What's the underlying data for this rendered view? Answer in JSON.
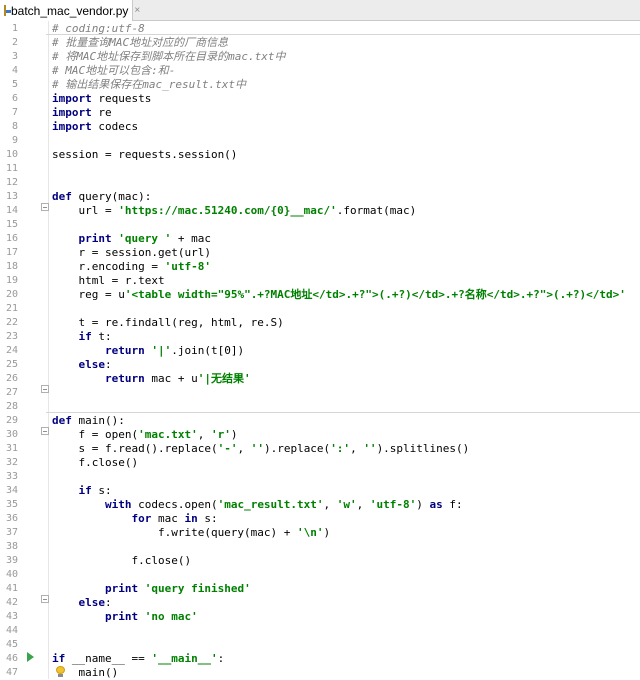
{
  "tab": {
    "filename": "batch_mac_vendor.py",
    "close": "×"
  },
  "editor": {
    "lines": [
      [
        {
          "t": "c",
          "v": "# coding:utf-8"
        }
      ],
      [
        {
          "t": "c",
          "v": "# 批量查询MAC地址对应的厂商信息"
        }
      ],
      [
        {
          "t": "c",
          "v": "# 将MAC地址保存到脚本所在目录的mac.txt中"
        }
      ],
      [
        {
          "t": "c",
          "v": "# MAC地址可以包含:和-"
        }
      ],
      [
        {
          "t": "c",
          "v": "# 输出结果保存在mac_result.txt中"
        }
      ],
      [
        {
          "t": "k",
          "v": "import"
        },
        {
          "t": "n",
          "v": " requests"
        }
      ],
      [
        {
          "t": "k",
          "v": "import"
        },
        {
          "t": "n",
          "v": " re"
        }
      ],
      [
        {
          "t": "k",
          "v": "import"
        },
        {
          "t": "n",
          "v": " codecs"
        }
      ],
      [],
      [
        {
          "t": "n",
          "v": "session = requests.session()"
        }
      ],
      [],
      [],
      [
        {
          "t": "k",
          "v": "def"
        },
        {
          "t": "n",
          "v": " query(mac):"
        }
      ],
      [
        {
          "t": "n",
          "v": "    url = "
        },
        {
          "t": "s",
          "v": "'https://mac.51240.com/{0}__mac/'"
        },
        {
          "t": "n",
          "v": ".format(mac)"
        }
      ],
      [],
      [
        {
          "t": "n",
          "v": "    "
        },
        {
          "t": "k",
          "v": "print"
        },
        {
          "t": "n",
          "v": " "
        },
        {
          "t": "s",
          "v": "'query '"
        },
        {
          "t": "n",
          "v": " + mac"
        }
      ],
      [
        {
          "t": "n",
          "v": "    r = session.get(url)"
        }
      ],
      [
        {
          "t": "n",
          "v": "    r.encoding = "
        },
        {
          "t": "s",
          "v": "'utf-8'"
        }
      ],
      [
        {
          "t": "n",
          "v": "    html = r.text"
        }
      ],
      [
        {
          "t": "n",
          "v": "    reg = u"
        },
        {
          "t": "s",
          "v": "'<table width=\"95%\".+?MAC地址</td>.+?\">(.+?)</td>.+?名称</td>.+?\">(.+?)</td>'"
        }
      ],
      [],
      [
        {
          "t": "n",
          "v": "    t = re.findall(reg, html, re.S)"
        }
      ],
      [
        {
          "t": "n",
          "v": "    "
        },
        {
          "t": "k",
          "v": "if"
        },
        {
          "t": "n",
          "v": " t:"
        }
      ],
      [
        {
          "t": "n",
          "v": "        "
        },
        {
          "t": "k",
          "v": "return"
        },
        {
          "t": "n",
          "v": " "
        },
        {
          "t": "s",
          "v": "'|'"
        },
        {
          "t": "n",
          "v": ".join(t[0])"
        }
      ],
      [
        {
          "t": "n",
          "v": "    "
        },
        {
          "t": "k",
          "v": "else"
        },
        {
          "t": "n",
          "v": ":"
        }
      ],
      [
        {
          "t": "n",
          "v": "        "
        },
        {
          "t": "k",
          "v": "return"
        },
        {
          "t": "n",
          "v": " mac + u"
        },
        {
          "t": "s",
          "v": "'|无结果'"
        }
      ],
      [],
      [],
      [
        {
          "t": "k",
          "v": "def"
        },
        {
          "t": "n",
          "v": " main():"
        }
      ],
      [
        {
          "t": "n",
          "v": "    f = open("
        },
        {
          "t": "s",
          "v": "'mac.txt'"
        },
        {
          "t": "n",
          "v": ", "
        },
        {
          "t": "s",
          "v": "'r'"
        },
        {
          "t": "n",
          "v": ")"
        }
      ],
      [
        {
          "t": "n",
          "v": "    s = f.read().replace("
        },
        {
          "t": "s",
          "v": "'-'"
        },
        {
          "t": "n",
          "v": ", "
        },
        {
          "t": "s",
          "v": "''"
        },
        {
          "t": "n",
          "v": ").replace("
        },
        {
          "t": "s",
          "v": "':'"
        },
        {
          "t": "n",
          "v": ", "
        },
        {
          "t": "s",
          "v": "''"
        },
        {
          "t": "n",
          "v": ").splitlines()"
        }
      ],
      [
        {
          "t": "n",
          "v": "    f.close()"
        }
      ],
      [],
      [
        {
          "t": "n",
          "v": "    "
        },
        {
          "t": "k",
          "v": "if"
        },
        {
          "t": "n",
          "v": " s:"
        }
      ],
      [
        {
          "t": "n",
          "v": "        "
        },
        {
          "t": "k",
          "v": "with"
        },
        {
          "t": "n",
          "v": " codecs.open("
        },
        {
          "t": "s",
          "v": "'mac_result.txt'"
        },
        {
          "t": "n",
          "v": ", "
        },
        {
          "t": "s",
          "v": "'w'"
        },
        {
          "t": "n",
          "v": ", "
        },
        {
          "t": "s",
          "v": "'utf-8'"
        },
        {
          "t": "n",
          "v": ") "
        },
        {
          "t": "k",
          "v": "as"
        },
        {
          "t": "n",
          "v": " f:"
        }
      ],
      [
        {
          "t": "n",
          "v": "            "
        },
        {
          "t": "k",
          "v": "for"
        },
        {
          "t": "n",
          "v": " mac "
        },
        {
          "t": "k",
          "v": "in"
        },
        {
          "t": "n",
          "v": " s:"
        }
      ],
      [
        {
          "t": "n",
          "v": "                f.write(query(mac) + "
        },
        {
          "t": "s",
          "v": "'\\n'"
        },
        {
          "t": "n",
          "v": ")"
        }
      ],
      [],
      [
        {
          "t": "n",
          "v": "            f.close()"
        }
      ],
      [],
      [
        {
          "t": "n",
          "v": "        "
        },
        {
          "t": "k",
          "v": "print"
        },
        {
          "t": "n",
          "v": " "
        },
        {
          "t": "s",
          "v": "'query finished'"
        }
      ],
      [
        {
          "t": "n",
          "v": "    "
        },
        {
          "t": "k",
          "v": "else"
        },
        {
          "t": "n",
          "v": ":"
        }
      ],
      [
        {
          "t": "n",
          "v": "        "
        },
        {
          "t": "k",
          "v": "print"
        },
        {
          "t": "n",
          "v": " "
        },
        {
          "t": "s",
          "v": "'no mac'"
        }
      ],
      [],
      [],
      [
        {
          "t": "k",
          "v": "if"
        },
        {
          "t": "n",
          "v": " __name__ == "
        },
        {
          "t": "s",
          "v": "'__main__'"
        },
        {
          "t": "n",
          "v": ":"
        }
      ],
      [
        {
          "t": "n",
          "v": "    main()"
        }
      ]
    ]
  }
}
